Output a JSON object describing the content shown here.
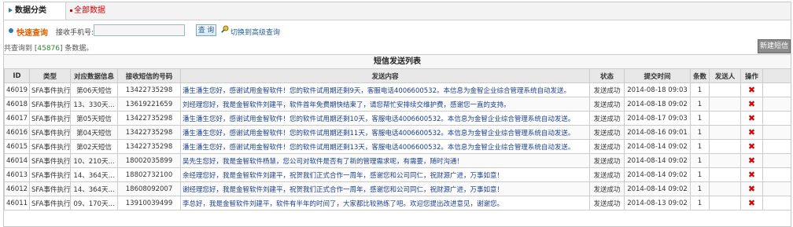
{
  "tabs": {
    "category": "数据分类",
    "all": "全部数据"
  },
  "search": {
    "quick_label": "快速查询",
    "phone_label": "接收手机号:",
    "phone_value": "",
    "query_button": "查 询",
    "advanced_link": "切换到高级查询"
  },
  "summary": {
    "prefix": "共查询到 [",
    "count": "45876",
    "suffix": "] 条数据。"
  },
  "new_button": "新建短信",
  "table": {
    "title": "短信发送列表",
    "headers": [
      "ID",
      "类型",
      "对应数据信息",
      "接收短信的号码",
      "发送内容",
      "状态",
      "提交时间",
      "条数",
      "发送人",
      "操作"
    ],
    "rows": [
      [
        "46019",
        "SFA事件执行",
        "第06天短信",
        "13422735298",
        "潘生潘生您好，感谢试用金智软件！您的软件试用期还剩9天，客服电话4006600532。本信息为金智企业综合管理系统自动发送。",
        "发送成功",
        "2014-08-18 09:03",
        "1",
        ""
      ],
      [
        "46018",
        "SFA事件执行",
        "13、330天...",
        "13619221659",
        "刘经理您好，我是金智软件刘建平，软件首年免费期快结束了，请您帮忙安排续交维护费，感谢您一直的支持。",
        "发送成功",
        "2014-08-18 09:02",
        "1",
        ""
      ],
      [
        "46017",
        "SFA事件执行",
        "第05天短信",
        "13422735298",
        "潘生潘生您好，感谢试用金智软件！您的软件试用期还剩10天，客服电话4006600532。本信息为金智企业综合管理系统自动发送。",
        "发送成功",
        "2014-08-17 09:03",
        "1",
        ""
      ],
      [
        "46016",
        "SFA事件执行",
        "第04天短信",
        "13422735298",
        "潘生潘生您好，感谢试用金智软件！您的软件试用期还剩11天，客服电话4006600532。本信息为金智企业综合管理系统自动发送。",
        "发送成功",
        "2014-08-16 09:01",
        "1",
        ""
      ],
      [
        "46015",
        "SFA事件执行",
        "第02天短信",
        "13422735298",
        "潘生潘生您好，感谢试用金智软件！您的软件试用期还剩13天，客服电话4006600532。本信息为金智企业综合管理系统自动发送。",
        "发送成功",
        "2014-08-14 09:02",
        "1",
        ""
      ],
      [
        "46014",
        "SFA事件执行",
        "10、210天...",
        "18002035899",
        "吴先生您好，我是金智软件杨慧，您公司对软件是否有了新的管理需求呢，有需要，随时沟通！",
        "发送成功",
        "2014-08-14 09:02",
        "1",
        ""
      ],
      [
        "46013",
        "SFA事件执行",
        "14、364天...",
        "18802732100",
        "余经理您好，我是金智软件刘建平，祝贺我们正式合作一周年，感谢您和公司同仁，祝财源广进，万事如意！",
        "发送成功",
        "2014-08-14 09:02",
        "1",
        ""
      ],
      [
        "46012",
        "SFA事件执行",
        "14、364天...",
        "18608092007",
        "谢经理您好，我是金智软件刘建平，祝贺我们正式合作一周年，感谢您和公司同仁，祝财源广进，万事如意！",
        "发送成功",
        "2014-08-14 09:02",
        "1",
        ""
      ],
      [
        "46011",
        "SFA事件执行",
        "09、170天...",
        "13910039499",
        "李总好，我是金智软件刘建平，软件有半年的时间了，大家都比较熟练了吧。欢迎您提出改进意见，谢谢您。",
        "发送成功",
        "2014-08-13 09:02",
        "1",
        ""
      ]
    ],
    "delete_symbol": "✖"
  },
  "colors": {
    "accent": "#2a7ab8",
    "danger": "#d90000",
    "link": "#1a3f8f",
    "count": "#2a8a2a"
  }
}
